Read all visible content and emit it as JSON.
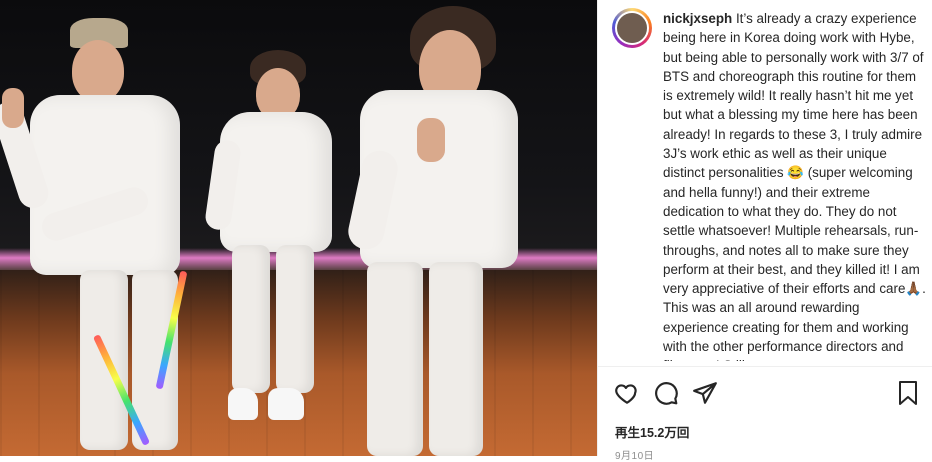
{
  "post": {
    "username": "nickjxseph",
    "caption_before_emoji1": "It’s already a crazy experience being here in Korea doing work with Hybe, but being able to personally work with 3/7 of BTS and choreograph this routine for them is extremely wild! It really hasn’t hit me yet but what a blessing my time here has been already! In regards to these 3, I truly admire 3J’s work ethic as well as their unique distinct personalities ",
    "emoji1": "😂",
    "caption_between": " (super welcoming and hella funny!) and their extreme dedication to what they do. They do not settle whatsoever! Multiple rehearsals, run-throughs, and notes all to make sure they perform at their best, and they killed it! I am very appreciative of their efforts and care",
    "emoji2": "🙏🏾",
    "caption_after": ". This was an all around rewarding experience creating for them and working with the other performance directors and film crew! Still",
    "views": "再生15.2万回",
    "date": "9月10日"
  },
  "icons": {
    "like": "heart-icon",
    "comment": "comment-icon",
    "share": "share-icon",
    "save": "bookmark-icon"
  },
  "colors": {
    "text": "#262626",
    "muted": "#8e8e8e",
    "floor_neon": "#ff8ce1"
  }
}
